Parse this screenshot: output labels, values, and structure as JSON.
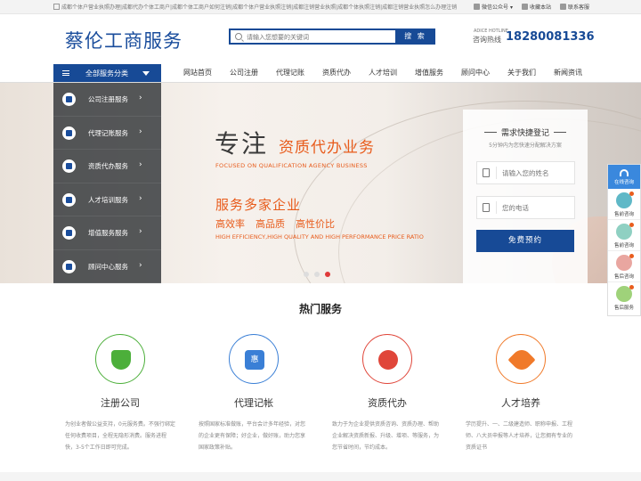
{
  "topbar": {
    "breadcrumb": "成都个体户营业执照办理|成都代办个体工商户|成都个体工商户如何注销|成都个体户营业执照注销|成都注销营业执照|成都个体执照注销|成都注销营业执照怎么办理注销",
    "links": [
      "微信公众号",
      "收藏本站",
      "联系客服"
    ]
  },
  "header": {
    "logo": "蔡伦工商服务",
    "search_placeholder": "请输入您想要的关键词",
    "search_button": "搜 索",
    "hotline_small": "ADICE HOTLINE",
    "hotline_label": "咨询热线",
    "hotline_phone": "18280081336"
  },
  "nav": {
    "all_categories": "全部服务分类",
    "items": [
      "网站首页",
      "公司注册",
      "代理记账",
      "资质代办",
      "人才培训",
      "增值服务",
      "顾问中心",
      "关于我们",
      "新闻资讯"
    ]
  },
  "categories": [
    "公司注册服务",
    "代理记账服务",
    "资质代办服务",
    "人才培训服务",
    "增值服务服务",
    "顾问中心服务"
  ],
  "banner": {
    "headline_a": "专注",
    "headline_b": "资质代办业务",
    "sub1": "FOCUSED ON QUALIFICATION AGENCY BUSINESS",
    "headline2": "服务多家企业",
    "points": [
      "高效率",
      "高品质",
      "高性价比"
    ],
    "sub2": "HIGH EFFICIENCY,HIGH QUALITY AND HIGH PERFORMANCE PRICE RATIO"
  },
  "form": {
    "title": "需求快捷登记",
    "tip": "5分钟内为您快速分配解决方案",
    "name_placeholder": "请输入您的姓名",
    "phone_placeholder": "您的电话",
    "submit": "免费预约"
  },
  "float": {
    "top": "在线咨询",
    "items": [
      "售前咨询",
      "售前咨询",
      "售后咨询",
      "售后服务"
    ]
  },
  "hot": {
    "title": "热门服务",
    "services": [
      {
        "name": "注册公司",
        "desc": "为创业者做公益支持，0元服务费。不强行绑定任何收费项目，全程无隐形消费。服务进程快，3-5个工作日即可完成。"
      },
      {
        "name": "代理记帐",
        "desc": "按照国家标准做账，平台会计多年经验，对您的企业更有保障；好企业，做好账，助力您享国家政策补贴。"
      },
      {
        "name": "资质代办",
        "desc": "致力于为企业提供资质咨询、资质办理、帮助企业解决资质新报、升级、增项、等服务，为您节省时间，节约成本。"
      },
      {
        "name": "人才培养",
        "desc": "学历提升、一、二级建造师、职称申报、工程师、八大员申报等人才培养，让您拥有专业的资质证书"
      }
    ]
  },
  "colors": {
    "primary": "#174a96",
    "accent": "#e85b1b",
    "green": "#4caf3a",
    "blue": "#3a7fd6",
    "red": "#e0463a",
    "orange": "#f07a2a"
  }
}
